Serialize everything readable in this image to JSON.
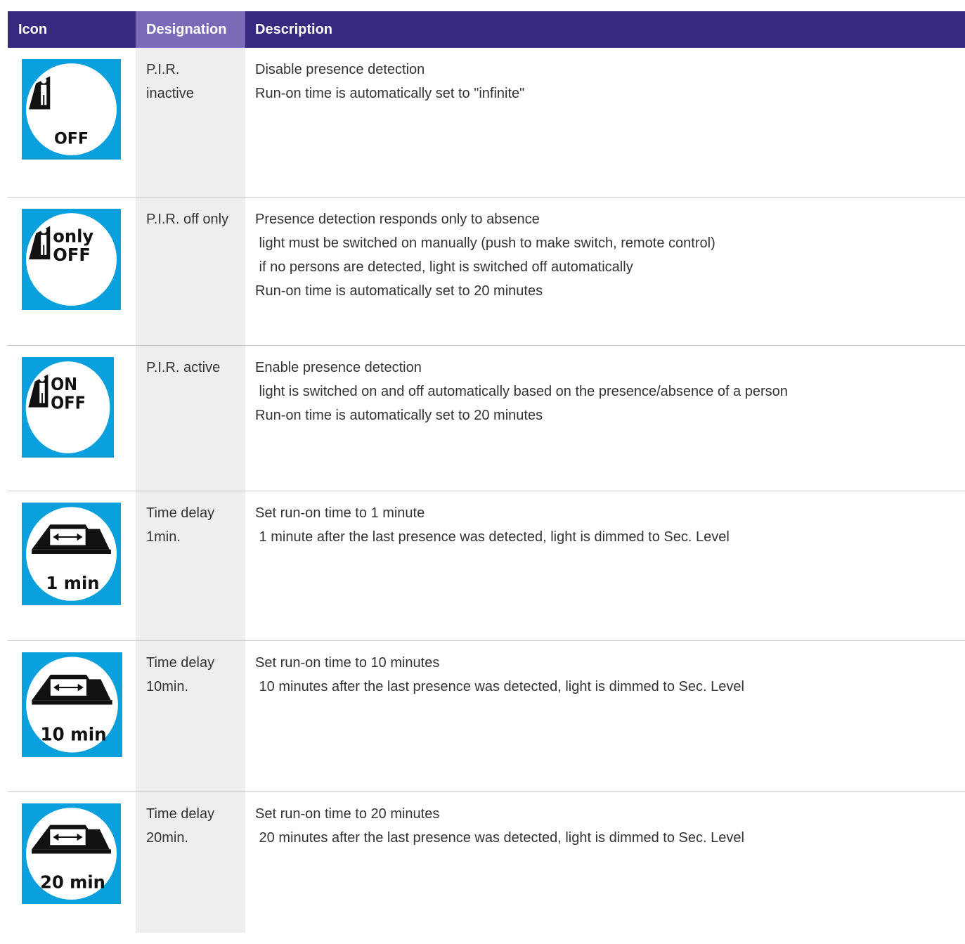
{
  "header": {
    "icon": "Icon",
    "designation": "Designation",
    "description": "Description"
  },
  "colors": {
    "header_bg": "#362a80",
    "header_highlight": "#7b6ab8",
    "icon_bg": "#0a9fdd",
    "column_shade": "#eeeeee"
  },
  "rows": [
    {
      "icon": "pir-off-icon",
      "icon_text": [
        "OFF"
      ],
      "designation": "P.I.R.\ninactive",
      "description": [
        "Disable presence detection",
        "Run-on time is automatically set to \"infinite\""
      ]
    },
    {
      "icon": "pir-only-off-icon",
      "icon_text": [
        "only",
        "OFF"
      ],
      "designation": "P.I.R. off only",
      "description": [
        "Presence detection responds only to absence",
        " light must be switched on manually (push to make switch, remote control)",
        " if no persons are detected, light is switched off automatically",
        "Run-on time is automatically set to 20 minutes"
      ]
    },
    {
      "icon": "pir-on-off-icon",
      "icon_text": [
        "ON",
        "OFF"
      ],
      "designation": "P.I.R. active",
      "description": [
        "Enable presence detection",
        " light is switched on and off automatically based on the presence/absence of a person",
        "Run-on time is automatically set to 20 minutes"
      ]
    },
    {
      "icon": "time-delay-1min-icon",
      "icon_text": [
        "1 min"
      ],
      "designation": "Time delay\n1min.",
      "description": [
        "Set run-on time to 1 minute",
        " 1 minute after the last presence was detected, light is dimmed to Sec. Level"
      ]
    },
    {
      "icon": "time-delay-10min-icon",
      "icon_text": [
        "10 min"
      ],
      "designation": "Time delay\n10min.",
      "description": [
        "Set run-on time to 10 minutes",
        " 10 minutes after the last presence was detected, light is dimmed to Sec. Level"
      ]
    },
    {
      "icon": "time-delay-20min-icon",
      "icon_text": [
        "20 min"
      ],
      "designation": "Time delay\n20min.",
      "description": [
        "Set run-on time to 20 minutes",
        " 20 minutes after the last presence was detected, light is dimmed to Sec. Level"
      ]
    }
  ]
}
